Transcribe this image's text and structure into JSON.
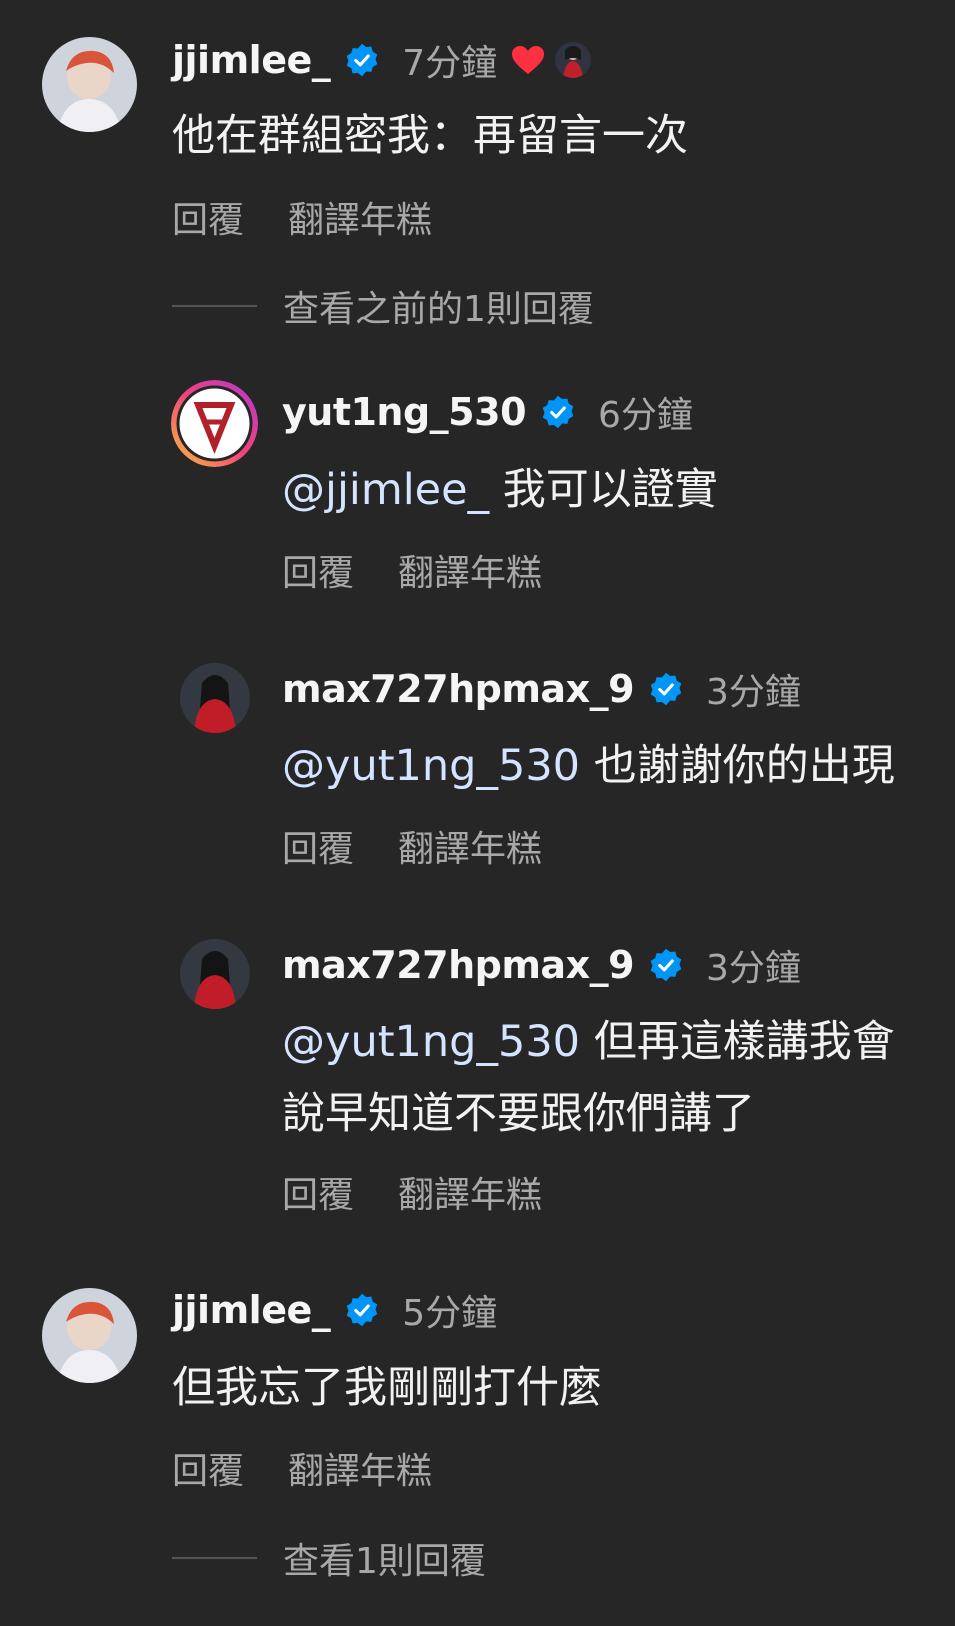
{
  "comments": [
    {
      "username": "jjimlee_",
      "time": "7分鐘",
      "text": "他在群組密我：再留言一次",
      "reply_label": "回覆",
      "translate_label": "翻譯年糕"
    },
    {
      "username": "yut1ng_530",
      "time": "6分鐘",
      "mention": "@jjimlee_",
      "text": "我可以證實",
      "reply_label": "回覆",
      "translate_label": "翻譯年糕"
    },
    {
      "username": "max727hpmax_9",
      "time": "3分鐘",
      "mention": "@yut1ng_530",
      "text": "也謝謝你的出現",
      "reply_label": "回覆",
      "translate_label": "翻譯年糕"
    },
    {
      "username": "max727hpmax_9",
      "time": "3分鐘",
      "mention": "@yut1ng_530",
      "text": "但再這樣講我會說早知道不要跟你們講了",
      "reply_label": "回覆",
      "translate_label": "翻譯年糕"
    },
    {
      "username": "jjimlee_",
      "time": "5分鐘",
      "text": "但我忘了我剛剛打什麼",
      "reply_label": "回覆",
      "translate_label": "翻譯年糕"
    }
  ],
  "view_previous_replies": "查看之前的1則回覆",
  "view_replies": "查看1則回覆",
  "colors": {
    "background": "#262627",
    "verified": "#0095f6",
    "heart": "#ff3040",
    "secondary_text": "#a8a8a8"
  }
}
